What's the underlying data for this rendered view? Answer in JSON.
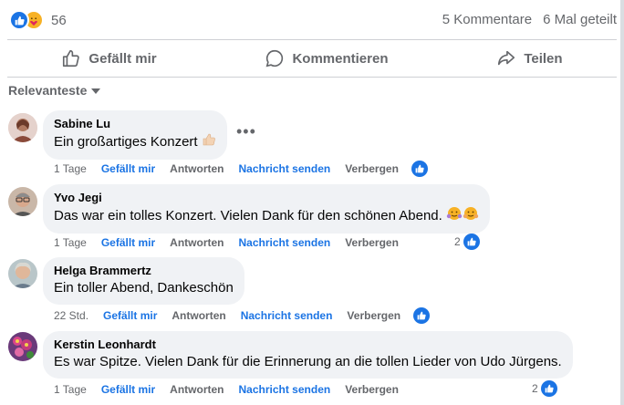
{
  "post": {
    "reaction_count": "56",
    "comments_count": "5 Kommentare",
    "shares_count": "6 Mal geteilt"
  },
  "actions": {
    "like": "Gefällt mir",
    "comment": "Kommentieren",
    "share": "Teilen"
  },
  "sort": {
    "label": "Relevanteste"
  },
  "comment_actions": {
    "like": "Gefällt mir",
    "reply": "Antworten",
    "message": "Nachricht senden",
    "hide": "Verbergen"
  },
  "comments": [
    {
      "author": "Sabine Lu",
      "text": "Ein großartiges Konzert",
      "time": "1 Tage",
      "likes": ""
    },
    {
      "author": "Yvo Jegi",
      "text": "Das war ein tolles Konzert. Vielen Dank für den schönen Abend.",
      "time": "1 Tage",
      "likes": "2"
    },
    {
      "author": "Helga Brammertz",
      "text": "Ein toller Abend, Dankeschön",
      "time": "22 Std.",
      "likes": ""
    },
    {
      "author": "Kerstin Leonhardt",
      "text": "Es war Spitze. Vielen Dank für die Erinnerung an die tollen Lieder von Udo Jürgens.",
      "time": "1 Tage",
      "likes": "2"
    }
  ],
  "colors": {
    "accent": "#1b74e4",
    "muted": "#65676b",
    "bubble": "#f0f2f5"
  }
}
